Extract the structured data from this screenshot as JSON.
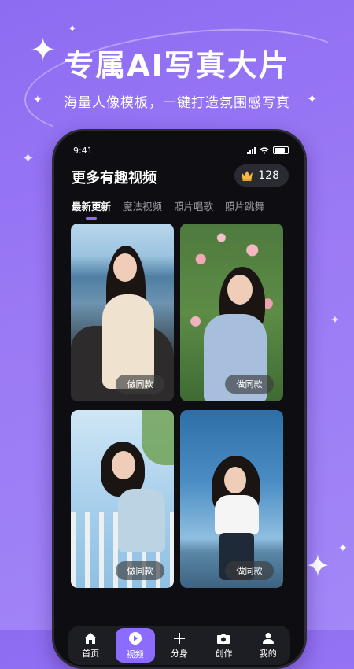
{
  "promo": {
    "headline": "专属AI写真大片",
    "subline": "海量人像模板，一键打造氛围感写真"
  },
  "status_bar": {
    "time": "9:41"
  },
  "header": {
    "title": "更多有趣视频",
    "coins": "128"
  },
  "tabs": [
    {
      "label": "最新更新",
      "active": true
    },
    {
      "label": "魔法视频",
      "active": false
    },
    {
      "label": "照片唱歌",
      "active": false
    },
    {
      "label": "照片跳舞",
      "active": false
    }
  ],
  "cards": [
    {
      "button": "做同款"
    },
    {
      "button": "做同款"
    },
    {
      "button": "做同款"
    },
    {
      "button": "做同款"
    }
  ],
  "bottom_nav": [
    {
      "label": "首页",
      "icon": "home-icon",
      "active": false
    },
    {
      "label": "视频",
      "icon": "play-icon",
      "active": true
    },
    {
      "label": "分身",
      "icon": "plus-icon",
      "active": false
    },
    {
      "label": "创作",
      "icon": "camera-icon",
      "active": false
    },
    {
      "label": "我的",
      "icon": "person-icon",
      "active": false
    }
  ],
  "colors": {
    "accent": "#8b6cff",
    "background": "#9b7af5",
    "phone_bg": "#0e0e12"
  }
}
